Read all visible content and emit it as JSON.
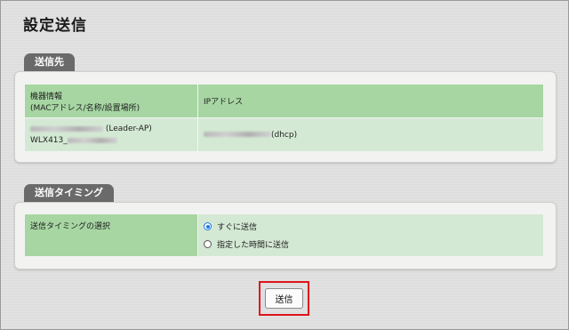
{
  "page": {
    "title": "設定送信"
  },
  "destination": {
    "tab_label": "送信先",
    "table": {
      "header": {
        "device_info_line1": "機器情報",
        "device_info_line2": "(MACアドレス/名称/設置場所)",
        "ip_address": "IPアドレス"
      },
      "row": {
        "role": "(Leader-AP)",
        "model_prefix": "WLX413_",
        "ip_suffix": "(dhcp)"
      }
    }
  },
  "timing": {
    "tab_label": "送信タイミング",
    "label": "送信タイミングの選択",
    "options": [
      {
        "label": "すぐに送信",
        "checked": true
      },
      {
        "label": "指定した時間に送信",
        "checked": false
      }
    ]
  },
  "actions": {
    "send_label": "送信"
  },
  "colors": {
    "header_green": "#a7d6a3",
    "cell_green": "#d4e9d4",
    "tab_gray": "#6a6a6a",
    "highlight_red": "#e0141c",
    "radio_blue": "#1a73e8"
  }
}
